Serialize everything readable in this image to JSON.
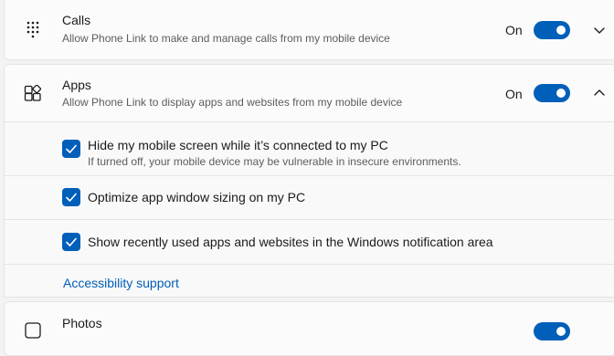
{
  "colors": {
    "accent": "#005fb8",
    "page_background": "#f3f3f3",
    "card_background": "#fbfbfb",
    "secondary_text": "#5d5d5d"
  },
  "calls": {
    "icon": "dialpad-icon",
    "title": "Calls",
    "description": "Allow Phone Link to make and manage calls from my mobile device",
    "toggle_state": "On",
    "toggle_on": true,
    "expanded": false
  },
  "apps": {
    "icon": "apps-icon",
    "title": "Apps",
    "description": "Allow Phone Link to display apps and websites from my mobile device",
    "toggle_state": "On",
    "toggle_on": true,
    "expanded": true,
    "options": [
      {
        "label": "Hide my mobile screen while it’s connected to my PC",
        "description": "If turned off, your mobile device may be vulnerable in insecure environments.",
        "checked": true
      },
      {
        "label": "Optimize app window sizing on my PC",
        "checked": true
      },
      {
        "label": "Show recently used apps and websites in the Windows notification area",
        "checked": true
      }
    ],
    "link": "Accessibility support"
  },
  "photos": {
    "icon": "photos-icon",
    "title": "Photos",
    "toggle_on": true
  }
}
